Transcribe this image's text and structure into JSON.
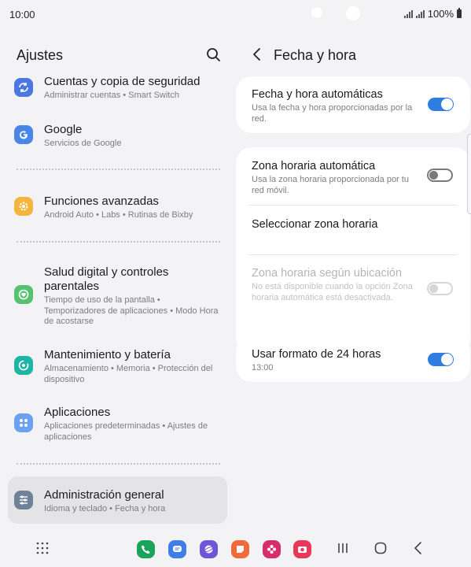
{
  "status": {
    "time": "10:00",
    "battery": "100%"
  },
  "left": {
    "title": "Ajustes",
    "items": [
      {
        "title": "Cuentas y copia de seguridad",
        "sub": "Administrar cuentas  •  Smart Switch",
        "icon": "sync-icon",
        "color": "#4a78e0"
      },
      {
        "title": "Google",
        "sub": "Servicios de Google",
        "icon": "google-icon",
        "color": "#4a86e8"
      },
      {
        "title": "Funciones avanzadas",
        "sub": "Android Auto  •  Labs  •  Rutinas de Bixby",
        "icon": "star-gear-icon",
        "color": "#f3b53b"
      },
      {
        "title": "Salud digital y controles parentales",
        "sub": "Tiempo de uso de la pantalla  •  Temporizadores de aplicaciones  •  Modo Hora de acostarse",
        "icon": "heart-circle-icon",
        "color": "#56c271"
      },
      {
        "title": "Mantenimiento y batería",
        "sub": "Almacenamiento  •  Memoria  •  Protección del dispositivo",
        "icon": "refresh-circle-icon",
        "color": "#1fb5a5"
      },
      {
        "title": "Aplicaciones",
        "sub": "Aplicaciones predeterminadas  •  Ajustes de aplicaciones",
        "icon": "apps-grid-icon",
        "color": "#6ba1f0"
      },
      {
        "title": "Administración general",
        "sub": "Idioma y teclado  •  Fecha y hora",
        "icon": "sliders-icon",
        "color": "#6e8398"
      }
    ]
  },
  "right": {
    "title": "Fecha y hora",
    "auto_datetime": {
      "label": "Fecha y hora automáticas",
      "desc": "Usa la fecha y hora proporcionadas por la red."
    },
    "auto_timezone": {
      "label": "Zona horaria automática",
      "desc": "Usa la zona horaria proporcionada por tu red móvil."
    },
    "select_timezone": {
      "label": "Seleccionar zona horaria"
    },
    "location_timezone": {
      "label": "Zona horaria según ubicación",
      "desc": "No está disponible cuando la opción Zona horaria automática está desactivada."
    },
    "format24": {
      "label": "Usar formato de 24 horas",
      "value": "13:00"
    }
  },
  "colors": {
    "accent": "#2f7de1",
    "background": "#f3f3f5",
    "card": "#ffffff"
  }
}
